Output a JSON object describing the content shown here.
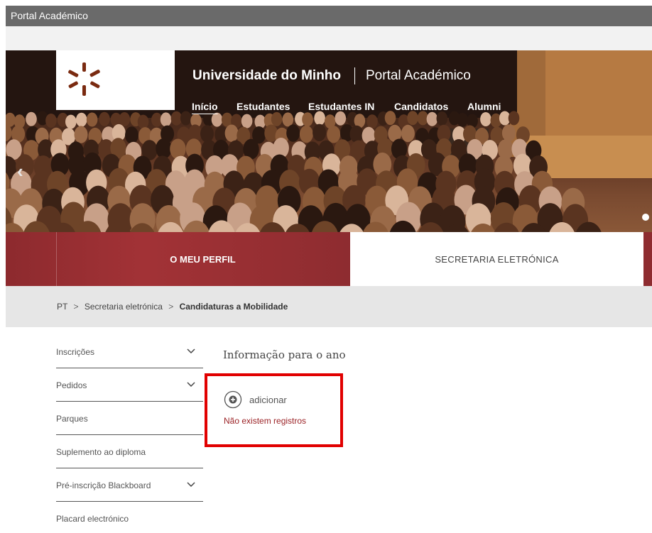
{
  "window": {
    "title": "Portal Académico"
  },
  "header": {
    "university": "Universidade do Minho",
    "portal": "Portal Académico",
    "nav": [
      {
        "label": "Início",
        "active": true
      },
      {
        "label": "Estudantes",
        "active": false
      },
      {
        "label": "Estudantes IN",
        "active": false
      },
      {
        "label": "Candidatos",
        "active": false
      },
      {
        "label": "Alumni",
        "active": false
      }
    ]
  },
  "carousel": {
    "prev_glyph": "‹"
  },
  "tabs": {
    "perfil": "O MEU PERFIL",
    "secretaria": "SECRETARIA ELETRÓNICA"
  },
  "breadcrumb": {
    "root": "PT",
    "separator": ">",
    "section": "Secretaria eletrónica",
    "current": "Candidaturas a Mobilidade"
  },
  "sidebar": {
    "items": [
      {
        "label": "Inscrições",
        "expandable": true
      },
      {
        "label": "Pedidos",
        "expandable": true
      },
      {
        "label": "Parques",
        "expandable": false
      },
      {
        "label": "Suplemento ao diploma",
        "expandable": false
      },
      {
        "label": "Pré-inscrição Blackboard",
        "expandable": true
      },
      {
        "label": "Placard electrónico",
        "expandable": false
      }
    ]
  },
  "content": {
    "title": "Informação para o ano",
    "add_label": "adicionar",
    "empty_message": "Não existem registros"
  },
  "colors": {
    "brand_red": "#9b2226",
    "highlight": "#e10000",
    "topbar": "#6a6a6a"
  },
  "icons": {
    "logo": "uminho-logo-icon",
    "chevron": "chevron-down-icon",
    "add": "plus-circle-icon",
    "prev": "chevron-left-icon"
  }
}
